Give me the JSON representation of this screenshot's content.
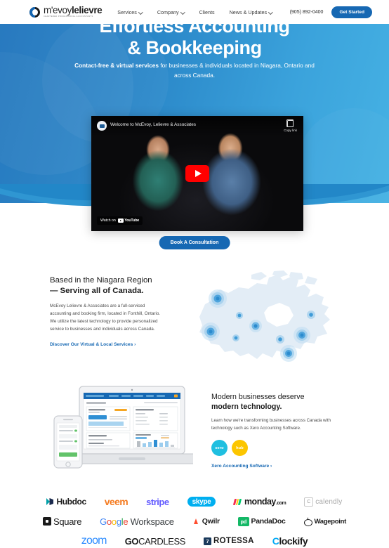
{
  "header": {
    "logo": {
      "name_light": "m'evoy",
      "name_bold": "lelievre",
      "tagline": "CHARTERED PROFESSIONAL ACCOUNTANTS",
      "mark_icon": "circle-split-icon"
    },
    "nav": [
      {
        "label": "Services",
        "has_dropdown": true
      },
      {
        "label": "Company",
        "has_dropdown": true
      },
      {
        "label": "Clients",
        "has_dropdown": false
      },
      {
        "label": "News & Updates",
        "has_dropdown": true
      }
    ],
    "phone": "(905) 892-0400",
    "cta_label": "Get Started"
  },
  "hero": {
    "title_line1": "Effortless Accounting",
    "title_line2": "& Bookkeeping",
    "sub_bold": "Contact-free & virtual services",
    "sub_rest": " for businesses & individuals located in Niagara, Ontario and across Canada.",
    "gradient_from": "#1f74bd",
    "gradient_to": "#46b2e4"
  },
  "video": {
    "title": "Welcome to McEvoy, Lelievre & Associates",
    "copy_link_label": "Copy link",
    "copy_link_icon": "copy-icon",
    "play_icon": "youtube-play-icon",
    "watch_on_label": "Watch on",
    "youtube_label": "YouTube",
    "avatar_icon": "channel-avatar-icon"
  },
  "consult_cta": {
    "label": "Book A  Consultation"
  },
  "section_region": {
    "heading_line1": "Based in the Niagara Region",
    "heading_line2": "— Serving all of Canada.",
    "paragraph": "McEvoy Lelievre & Associates are a full-serviced accounting and booking firm, located in Fonthill, Ontario. We utilize the latest technology to provide personalized service to businesses and individuals across Canada.",
    "link_label": "Discover Our Virtual & Local Services ›",
    "map_name": "canada-map"
  },
  "section_tech": {
    "heading_line1": "Modern businesses deserve",
    "heading_line2": "modern technology.",
    "paragraph": "Learn how we're transforming businesses across Canada with technology such as Xero Accounting Software.",
    "badges": [
      {
        "label": "xero",
        "color": "#1fbfe0"
      },
      {
        "label": "hub",
        "color": "#fcc600"
      }
    ],
    "link_label": "Xero Accounting Software ›",
    "device_name": "laptop-and-phone-mockup"
  },
  "partner_logos": {
    "row1": [
      {
        "name": "hubdoc",
        "text": "Hubdoc"
      },
      {
        "name": "veem",
        "text": "veem"
      },
      {
        "name": "stripe",
        "text": "stripe"
      },
      {
        "name": "skype",
        "text": "skype"
      },
      {
        "name": "monday",
        "text": "monday",
        "suffix": ".com"
      },
      {
        "name": "calendly",
        "text": "calendly",
        "icon_letter": "C"
      }
    ],
    "row2": [
      {
        "name": "square",
        "text": "Square"
      },
      {
        "name": "google-workspace",
        "g": "G",
        "o1": "o",
        "o2": "o",
        "g2": "g",
        "l": "l",
        "e": "e",
        "rest": " Workspace"
      },
      {
        "name": "qwilr",
        "text": "Qwilr"
      },
      {
        "name": "pandadoc",
        "text": "PandaDoc",
        "icon_text": "pd"
      },
      {
        "name": "wagepoint",
        "text": "Wagepoint"
      }
    ],
    "row3": [
      {
        "name": "zoom",
        "text": "zoom"
      },
      {
        "name": "gocardless",
        "bold": "GO",
        "rest": "CARDLESS"
      },
      {
        "name": "rotessa",
        "text": "ROTESSA",
        "icon_letter": "7"
      },
      {
        "name": "clockify",
        "first": "C",
        "rest": "lockify"
      }
    ]
  }
}
